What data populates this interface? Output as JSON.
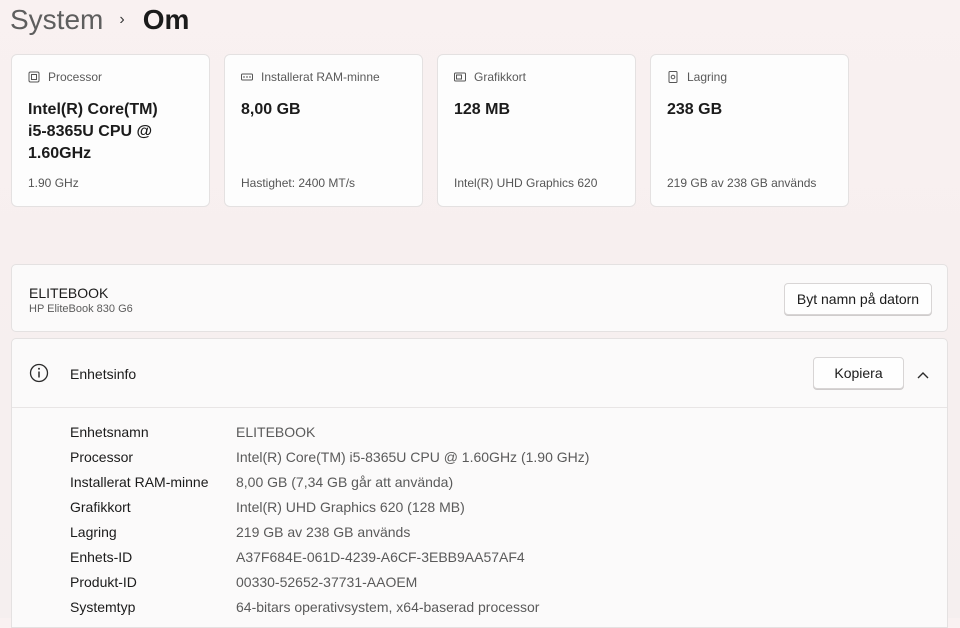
{
  "breadcrumb": {
    "parent": "System",
    "separator": "›",
    "current": "Om"
  },
  "cards": [
    {
      "label": "Processor",
      "icon": "cpu-icon",
      "value": "Intel(R) Core(TM) i5-8365U CPU @ 1.60GHz",
      "sub": "1.90 GHz"
    },
    {
      "label": "Installerat RAM-minne",
      "icon": "ram-icon",
      "value": "8,00 GB",
      "sub": "Hastighet: 2400 MT/s"
    },
    {
      "label": "Grafikkort",
      "icon": "gpu-icon",
      "value": "128 MB",
      "sub": "Intel(R) UHD Graphics 620"
    },
    {
      "label": "Lagring",
      "icon": "storage-icon",
      "value": "238 GB",
      "sub": "219 GB av 238 GB används"
    }
  ],
  "device": {
    "name": "ELITEBOOK",
    "model": "HP EliteBook 830 G6",
    "rename_label": "Byt namn på datorn"
  },
  "device_info": {
    "title": "Enhetsinfo",
    "copy_label": "Kopiera",
    "rows": [
      {
        "label": "Enhetsnamn",
        "value": "ELITEBOOK"
      },
      {
        "label": "Processor",
        "value": "Intel(R) Core(TM) i5-8365U CPU @ 1.60GHz (1.90 GHz)"
      },
      {
        "label": "Installerat RAM-minne",
        "value": "8,00 GB (7,34 GB går att använda)"
      },
      {
        "label": "Grafikkort",
        "value": "Intel(R) UHD Graphics 620 (128 MB)"
      },
      {
        "label": "Lagring",
        "value": "219 GB av 238 GB används"
      },
      {
        "label": "Enhets-ID",
        "value": "A37F684E-061D-4239-A6CF-3EBB9AA57AF4"
      },
      {
        "label": "Produkt-ID",
        "value": "00330-52652-37731-AAOEM"
      },
      {
        "label": "Systemtyp",
        "value": "64-bitars operativsystem, x64-baserad processor"
      }
    ]
  }
}
